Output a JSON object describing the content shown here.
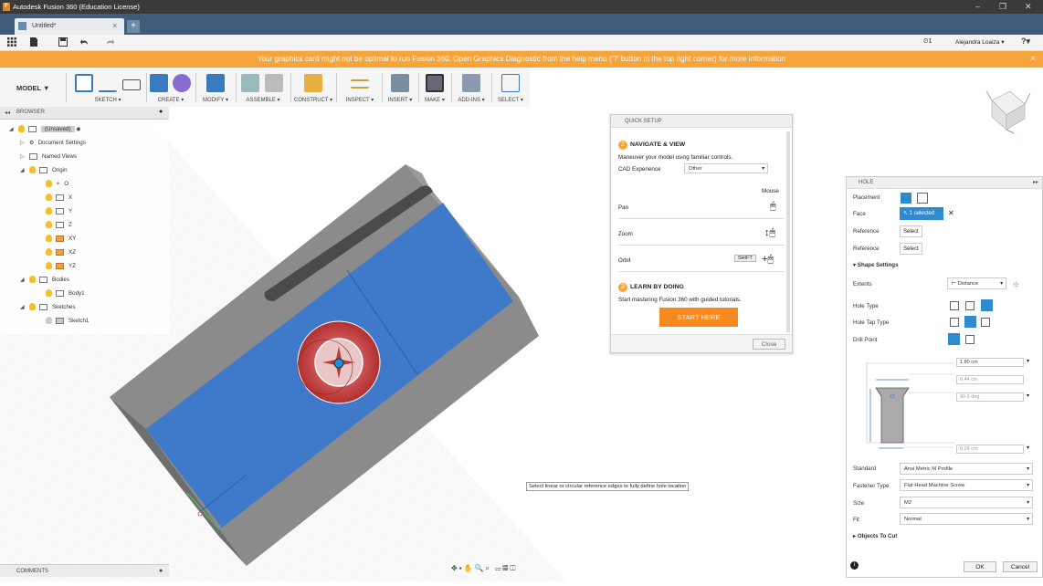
{
  "window": {
    "title": "Autodesk Fusion 360 (Education License)",
    "controls": [
      "–",
      "❐",
      "✕"
    ]
  },
  "tab": {
    "name": "Untitled*",
    "close": "×",
    "add": "+"
  },
  "appbar": {
    "jobs": "1",
    "user": "Alejandra Loaiza ▾",
    "help": "?▾"
  },
  "warning": {
    "text": "Your graphics card might not be optimal to run Fusion 360. Open Graphics Diagnostic from the help menu ('?' button in the top right corner) for more information",
    "close": "×"
  },
  "toolbar": {
    "model": "MODEL ▼",
    "groups": [
      "SKETCH ▾",
      "CREATE ▾",
      "MODIFY ▾",
      "ASSEMBLE ▾",
      "CONSTRUCT ▾",
      "INSPECT ▾",
      "INSERT ▾",
      "MAKE ▾",
      "ADD-INS ▾",
      "SELECT ▾"
    ]
  },
  "browser": {
    "title": "BROWSER",
    "items": [
      {
        "label": "(Unsaved)",
        "indent": 0
      },
      {
        "label": "Document Settings",
        "indent": 1
      },
      {
        "label": "Named Views",
        "indent": 1
      },
      {
        "label": "Origin",
        "indent": 1
      },
      {
        "label": "O",
        "indent": 2
      },
      {
        "label": "X",
        "indent": 2
      },
      {
        "label": "Y",
        "indent": 2
      },
      {
        "label": "Z",
        "indent": 2
      },
      {
        "label": "XY",
        "indent": 2
      },
      {
        "label": "XZ",
        "indent": 2
      },
      {
        "label": "YZ",
        "indent": 2
      },
      {
        "label": "Bodies",
        "indent": 1
      },
      {
        "label": "Body1",
        "indent": 2
      },
      {
        "label": "Sketches",
        "indent": 1
      },
      {
        "label": "Sketch1",
        "indent": 2
      }
    ]
  },
  "comments": {
    "title": "COMMENTS"
  },
  "quick_setup": {
    "title": "QUICK SETUP",
    "nav_num": "2",
    "nav_title": "NAVIGATE & VIEW",
    "nav_desc": "Maneuver your model using familiar controls.",
    "cad_label": "CAD Experience",
    "cad_value": "Other",
    "mouse": "Mouse",
    "pan": "Pan",
    "zoom": "Zoom",
    "orbit": "Orbit",
    "shift": "SHIFT",
    "learn_num": "3",
    "learn_title": "LEARN BY DOING",
    "learn_desc": "Start mastering Fusion 360 with guided tutorials.",
    "start": "START HERE",
    "close": "Close"
  },
  "hole": {
    "title": "HOLE",
    "placement": "Placement",
    "face": "Face",
    "face_value": "1 selected",
    "reference1": "Reference",
    "reference2": "Reference",
    "select": "Select",
    "shape_settings": "Shape Settings",
    "extents": "Extents",
    "extents_value": "Distance",
    "hole_type": "Hole Type",
    "hole_tap_type": "Hole Tap Type",
    "drill_point": "Drill Point",
    "dims": [
      "1.80 cm",
      "0.44 cm",
      "90.0 deg",
      "0.24 cm"
    ],
    "standard": "Standard",
    "standard_value": "Ansi Metric M Profile",
    "fastener": "Fastener Type",
    "fastener_value": "Flat Head Machine Screw",
    "size": "Size",
    "size_value": "M2",
    "fit": "Fit",
    "fit_value": "Normal",
    "objects_to_cut": "Objects To Cut",
    "ok": "OK",
    "cancel": "Cancel"
  },
  "tooltip": {
    "text": "Select linear or circular reference edges to fully define hole location"
  },
  "colors": {
    "accent": "#f7a43a",
    "face": "#3f79c9",
    "body": "#8a8a8a",
    "select": "#2e8bd0"
  }
}
